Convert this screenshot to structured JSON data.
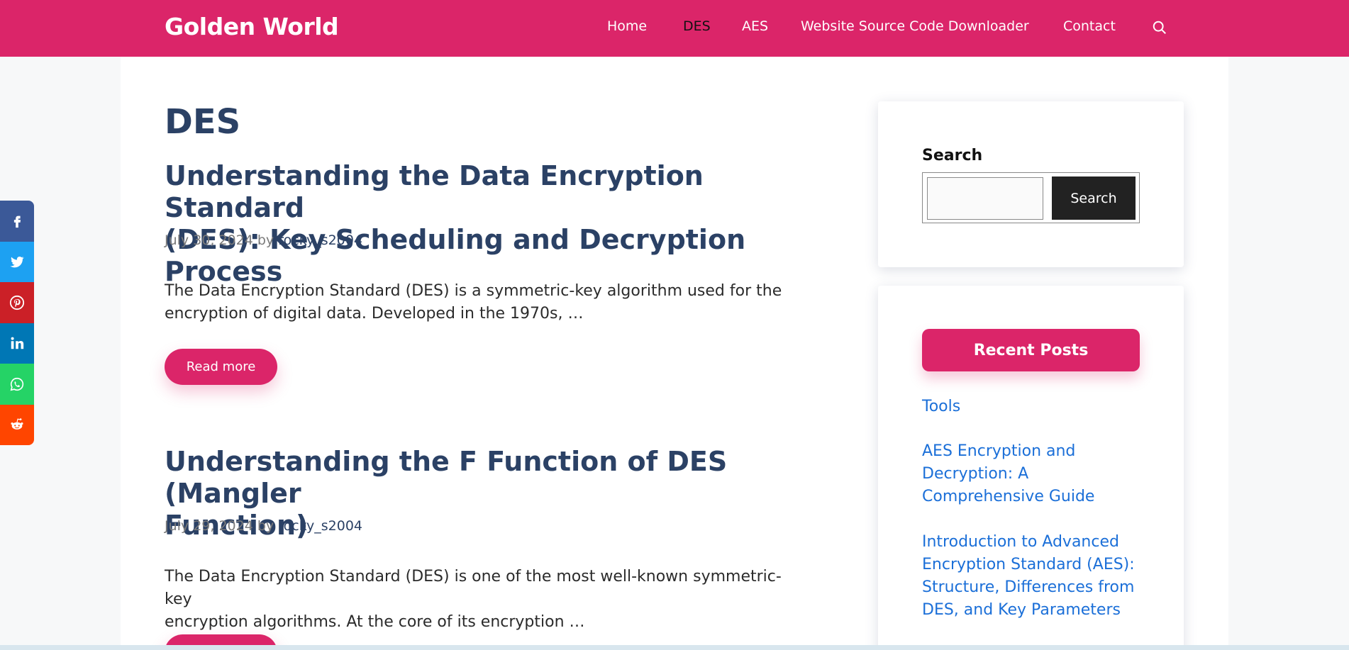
{
  "header": {
    "site_title": "Golden World",
    "nav": [
      {
        "label": "Home",
        "active": false
      },
      {
        "label": "DES",
        "active": true
      },
      {
        "label": "AES",
        "active": false
      },
      {
        "label": "Website Source Code Downloader",
        "active": false
      },
      {
        "label": "Contact",
        "active": false
      }
    ],
    "search_icon": "search-icon"
  },
  "main": {
    "page_title": "DES",
    "posts": [
      {
        "title_line1": "Understanding the Data Encryption Standard",
        "title_line2": "(DES): Key Scheduling and Decryption Process",
        "date": "July 30, 2024",
        "by": "by",
        "author": "rocky_s2004",
        "excerpt_line1": "The Data Encryption Standard (DES) is a symmetric-key algorithm used for the",
        "excerpt_line2": "encryption of digital data. Developed in the 1970s, …",
        "read_more": "Read more"
      },
      {
        "title_line1": "Understanding the F Function of DES (Mangler",
        "title_line2": "Function)",
        "date": "July 29, 2024",
        "by": "by",
        "author": "rocky_s2004",
        "excerpt_line1": "The Data Encryption Standard (DES) is one of the most well-known symmetric-key",
        "excerpt_line2": "encryption algorithms. At the core of its encryption …",
        "read_more": "Read more"
      }
    ]
  },
  "sidebar": {
    "search": {
      "label": "Search",
      "input_value": "",
      "button_label": "Search"
    },
    "recent_posts": {
      "heading": "Recent Posts",
      "items": [
        {
          "line1": "Tools"
        },
        {
          "line1": "AES Encryption and",
          "line2": "Decryption: A",
          "line3": "Comprehensive Guide"
        },
        {
          "line1": "Introduction to Advanced",
          "line2": "Encryption Standard (AES):",
          "line3": "Structure, Differences from",
          "line4": "DES, and Key Parameters"
        }
      ]
    }
  },
  "share_bar": [
    {
      "icon": "facebook-icon",
      "color": "#3b5998"
    },
    {
      "icon": "twitter-icon",
      "color": "#1da1f2"
    },
    {
      "icon": "pinterest-icon",
      "color": "#cb2027"
    },
    {
      "icon": "linkedin-icon",
      "color": "#0077b5"
    },
    {
      "icon": "whatsapp-icon",
      "color": "#25d366"
    },
    {
      "icon": "reddit-icon",
      "color": "#ff4500"
    }
  ],
  "colors": {
    "brand": "#db2569",
    "heading": "#2b4165",
    "link": "#1b6fd8"
  }
}
